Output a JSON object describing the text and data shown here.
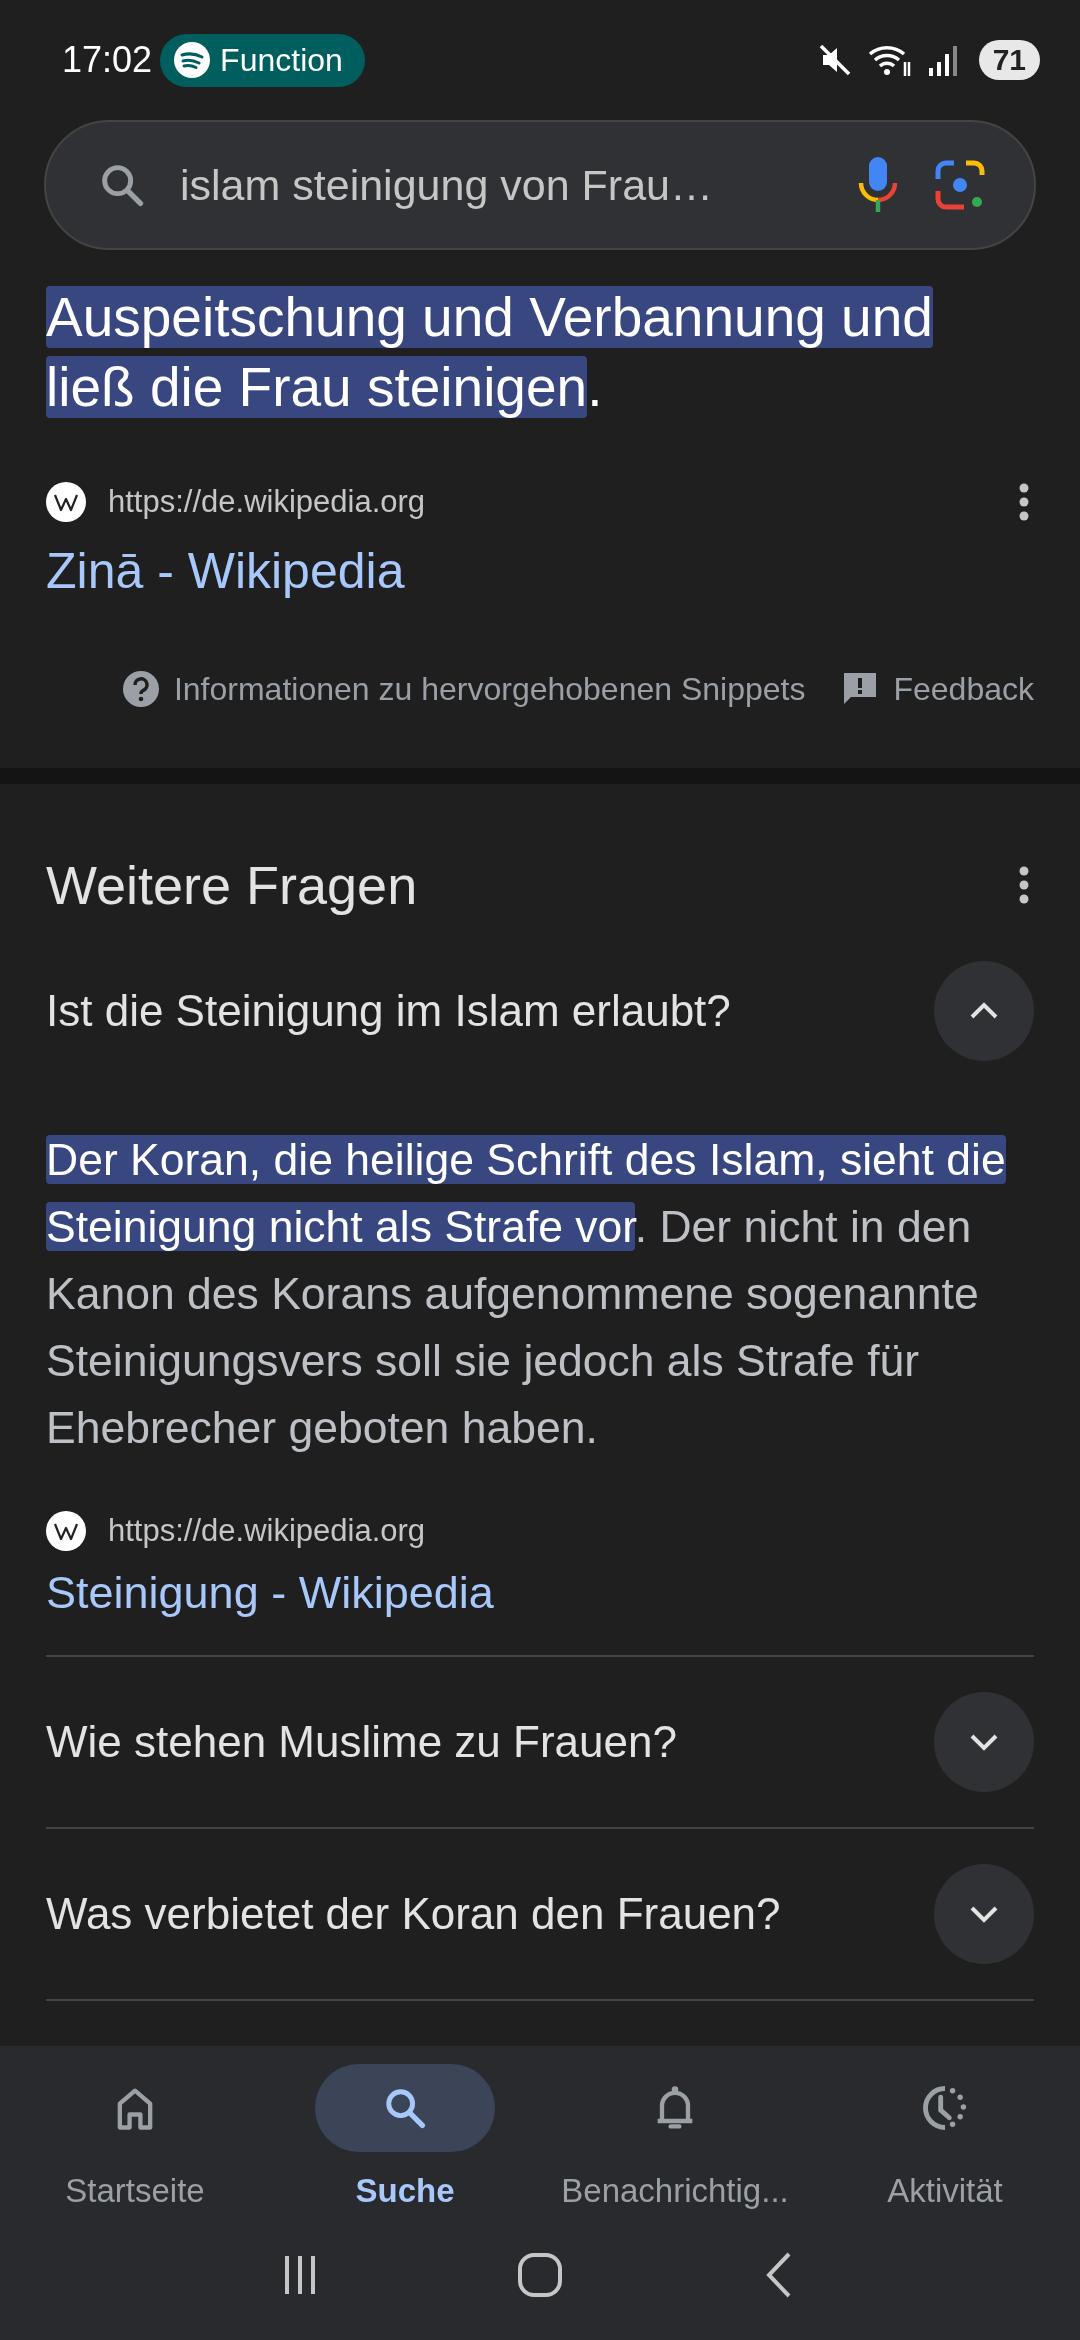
{
  "status_bar": {
    "time": "17:02",
    "media_chip": "Function",
    "battery": "71"
  },
  "search": {
    "value": "islam steinigung von Frau…"
  },
  "snippet": {
    "highlighted": "Auspeitschung und Verbannung und ließ die Frau steinigen",
    "trailing": ".",
    "source_url": "https://de.wikipedia.org",
    "title": "Zinā - Wikipedia",
    "info_link": "Informationen zu hervorgehobenen Snippets",
    "feedback": "Feedback"
  },
  "more_questions": {
    "heading": "Weitere Fragen",
    "items": [
      {
        "question": "Ist die Steinigung im Islam erlaubt?",
        "expanded": true,
        "answer_highlight": " Der Koran, die heilige Schrift des Islam, sieht die Steinigung nicht als Strafe vor",
        "answer_rest": ". Der nicht in den Kanon des Korans aufgenommene sogenannte Steinigungsvers soll sie jedoch als Strafe für Ehebrecher geboten haben.",
        "source_url": "https://de.wikipedia.org",
        "source_title": "Steinigung - Wikipedia"
      },
      {
        "question": "Wie stehen Muslime zu Frauen?",
        "expanded": false
      },
      {
        "question": "Was verbietet der Koran den Frauen?",
        "expanded": false
      }
    ]
  },
  "bottom_nav": [
    {
      "label": "Startseite",
      "selected": false
    },
    {
      "label": "Suche",
      "selected": true
    },
    {
      "label": "Benachrichtig...",
      "selected": false
    },
    {
      "label": "Aktivität",
      "selected": false
    }
  ]
}
